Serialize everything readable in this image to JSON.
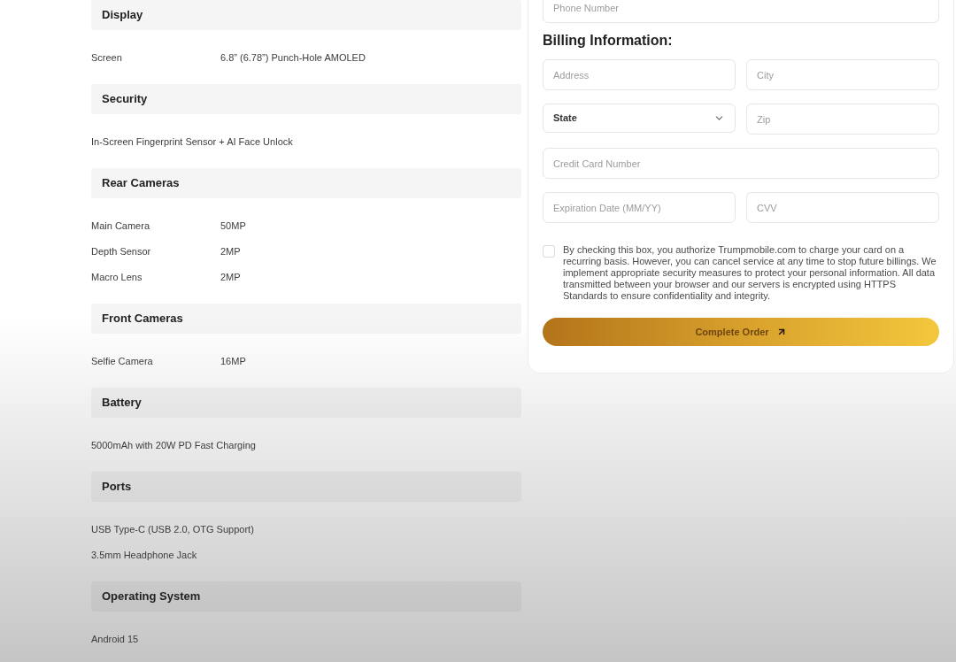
{
  "specs": [
    {
      "title": "Display",
      "rows": [
        {
          "kind": "pair",
          "label": "Screen",
          "value": "6.8” (6.78”) Punch-Hole AMOLED"
        }
      ]
    },
    {
      "title": "Security",
      "rows": [
        {
          "kind": "text",
          "value": "In-Screen Fingerprint Sensor + AI Face Unlock"
        }
      ]
    },
    {
      "title": "Rear Cameras",
      "rows": [
        {
          "kind": "pair",
          "label": "Main Camera",
          "value": "50MP"
        },
        {
          "kind": "pair",
          "label": "Depth Sensor",
          "value": "2MP"
        },
        {
          "kind": "pair",
          "label": "Macro Lens",
          "value": "2MP"
        }
      ]
    },
    {
      "title": "Front Cameras",
      "rows": [
        {
          "kind": "pair",
          "label": "Selfie Camera",
          "value": "16MP"
        }
      ]
    },
    {
      "title": "Battery",
      "rows": [
        {
          "kind": "text",
          "value": "5000mAh with 20W PD Fast Charging"
        }
      ]
    },
    {
      "title": "Ports",
      "rows": [
        {
          "kind": "text",
          "value": "USB Type-C (USB 2.0, OTG Support)"
        },
        {
          "kind": "text",
          "value": "3.5mm Headphone Jack"
        }
      ]
    },
    {
      "title": "Operating System",
      "rows": [
        {
          "kind": "text",
          "value": "Android 15"
        }
      ]
    }
  ],
  "checkout": {
    "phone_field": {
      "placeholder": "Phone Number"
    },
    "billing_heading": "Billing Information:",
    "field_rows": [
      [
        {
          "kind": "input",
          "placeholder": "Address"
        },
        {
          "kind": "input",
          "placeholder": "City"
        }
      ],
      [
        {
          "kind": "select",
          "value": "State"
        },
        {
          "kind": "input",
          "placeholder": "Zip"
        }
      ],
      [
        {
          "kind": "input",
          "placeholder": "Credit Card Number"
        }
      ],
      [
        {
          "kind": "input",
          "placeholder": "Expiration Date (MM/YY)"
        },
        {
          "kind": "input",
          "placeholder": "CVV"
        }
      ]
    ],
    "consent": {
      "checked": false,
      "text": "By checking this box, you authorize Trumpmobile.com to charge your card on a recurring basis. However, you can cancel service at any time to stop future billings. We implement appropriate security measures to protect your personal information. All data transmitted between your browser and our servers is encrypted using HTTPS Standards to ensure confidentiality and integrity."
    },
    "submit_button": {
      "label": "Complete Order"
    }
  }
}
